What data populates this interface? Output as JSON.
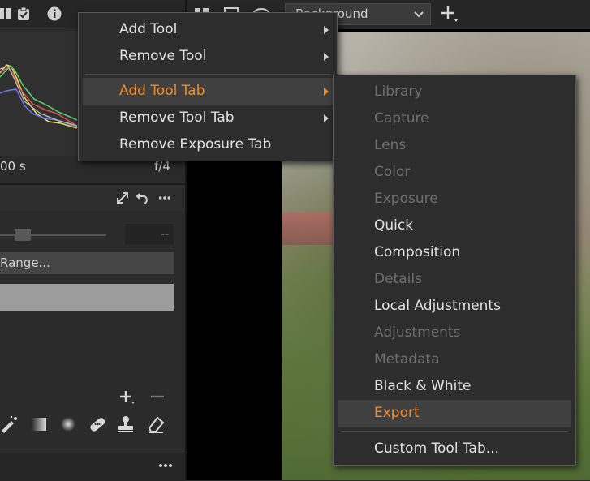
{
  "left_panel": {
    "shutter_text": "00 s",
    "aperture_text": "f/4",
    "value_box": "--",
    "range_select": "Range...",
    "brush_tools": [
      "brush-icon",
      "gradient-icon",
      "radial-icon",
      "heal-icon",
      "stamp-icon",
      "eraser-icon"
    ]
  },
  "top_toolbar": {
    "background_select": "Background"
  },
  "context_menu": {
    "items": [
      {
        "label": "Add Tool",
        "has_submenu": true
      },
      {
        "label": "Remove Tool",
        "has_submenu": true
      },
      {
        "label": "Add Tool Tab",
        "has_submenu": true,
        "active": true
      },
      {
        "label": "Remove Tool Tab",
        "has_submenu": true
      },
      {
        "label": "Remove Exposure Tab",
        "has_submenu": false
      }
    ]
  },
  "submenu": {
    "items": [
      {
        "label": "Library",
        "enabled": false
      },
      {
        "label": "Capture",
        "enabled": false
      },
      {
        "label": "Lens",
        "enabled": false
      },
      {
        "label": "Color",
        "enabled": false
      },
      {
        "label": "Exposure",
        "enabled": false
      },
      {
        "label": "Quick",
        "enabled": true
      },
      {
        "label": "Composition",
        "enabled": true
      },
      {
        "label": "Details",
        "enabled": false
      },
      {
        "label": "Local Adjustments",
        "enabled": true
      },
      {
        "label": "Adjustments",
        "enabled": false
      },
      {
        "label": "Metadata",
        "enabled": false
      },
      {
        "label": "Black & White",
        "enabled": true
      },
      {
        "label": "Export",
        "enabled": true,
        "highlighted": true
      },
      {
        "label": "Custom Tool Tab...",
        "enabled": true
      }
    ]
  },
  "colors": {
    "accent": "#f28c28",
    "disabled_text": "#6e6e6e",
    "menu_bg": "#2d2d2d"
  }
}
